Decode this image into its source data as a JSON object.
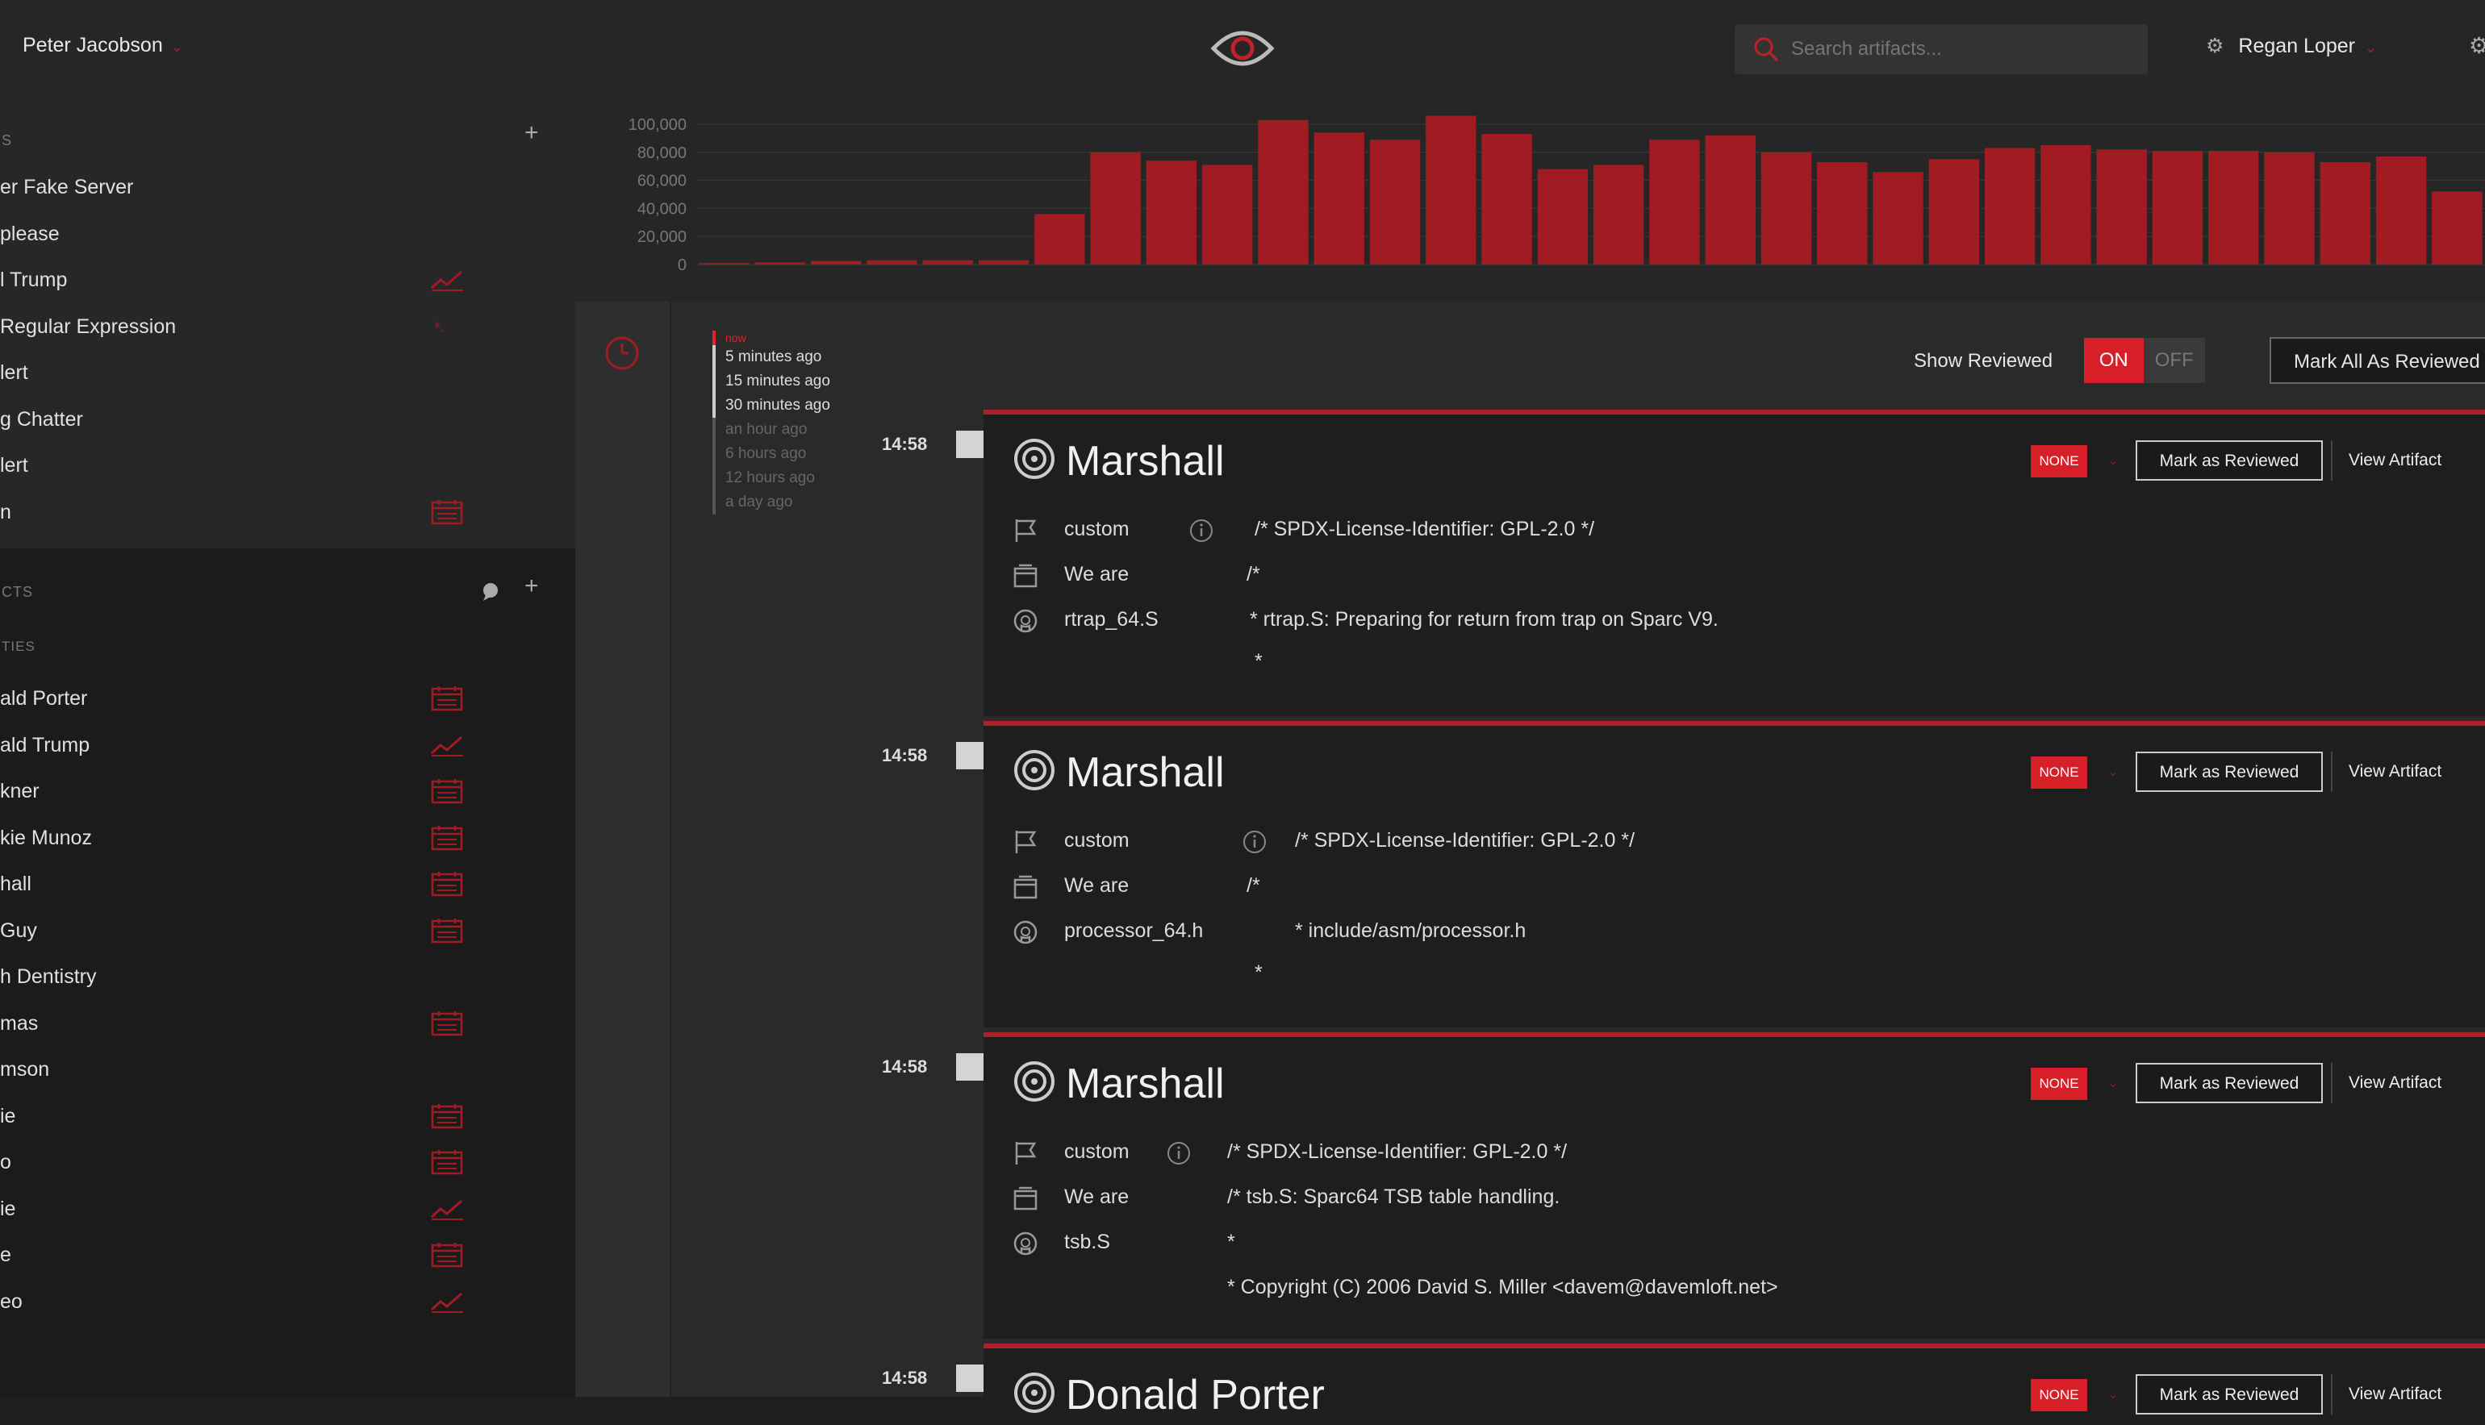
{
  "header": {
    "user_left": "Peter Jacobson",
    "search_placeholder": "Search artifacts...",
    "user_right": "Regan Loper"
  },
  "sidebar": {
    "section1_label": "S",
    "section1_items": [
      {
        "label": "er Fake Server",
        "icon": ""
      },
      {
        "label": "please",
        "icon": ""
      },
      {
        "label": "l Trump",
        "icon": "graph-icon"
      },
      {
        "label": "Regular Expression",
        "icon": "regex-icon"
      },
      {
        "label": "lert",
        "icon": ""
      },
      {
        "label": "g Chatter",
        "icon": ""
      },
      {
        "label": "lert",
        "icon": ""
      },
      {
        "label": "n",
        "icon": "calendar-icon"
      }
    ],
    "section2_label": "CTS",
    "section2_sub": "TIES",
    "section2_items": [
      {
        "label": "ald Porter",
        "icon": "calendar-icon"
      },
      {
        "label": "ald Trump",
        "icon": "graph-icon"
      },
      {
        "label": "kner",
        "icon": "calendar-icon"
      },
      {
        "label": "kie Munoz",
        "icon": "calendar-icon"
      },
      {
        "label": "hall",
        "icon": "calendar-icon"
      },
      {
        "label": " Guy",
        "icon": "calendar-icon"
      },
      {
        "label": "h Dentistry",
        "icon": ""
      },
      {
        "label": "mas",
        "icon": "calendar-icon"
      },
      {
        "label": "mson",
        "icon": ""
      },
      {
        "label": "ie",
        "icon": "calendar-icon"
      },
      {
        "label": "o",
        "icon": "calendar-icon"
      },
      {
        "label": "ie",
        "icon": "graph-icon"
      },
      {
        "label": "e",
        "icon": "calendar-icon"
      },
      {
        "label": "eo",
        "icon": "graph-icon"
      }
    ]
  },
  "chart_data": {
    "type": "bar",
    "yticks": [
      "100,000",
      "80,000",
      "60,000",
      "40,000",
      "20,000",
      "0"
    ],
    "ylim": [
      0,
      100000
    ],
    "values": [
      1000,
      1500,
      2500,
      3000,
      3000,
      3000,
      36000,
      80000,
      74000,
      71000,
      103000,
      94000,
      89000,
      106000,
      93000,
      68000,
      71000,
      89000,
      92000,
      80000,
      73000,
      66000,
      75000,
      83000,
      85000,
      82000,
      81000,
      81000,
      80000,
      73000,
      77000,
      52000
    ],
    "color": "#a01c22"
  },
  "timeline": {
    "filters": [
      {
        "label": "now",
        "state": "now"
      },
      {
        "label": "5 minutes ago",
        "state": "active"
      },
      {
        "label": "15 minutes ago",
        "state": "active"
      },
      {
        "label": "30 minutes ago",
        "state": "active"
      },
      {
        "label": "an hour ago",
        "state": "dim"
      },
      {
        "label": "6 hours ago",
        "state": "dim"
      },
      {
        "label": "12 hours ago",
        "state": "dim"
      },
      {
        "label": "a day ago",
        "state": "dim"
      }
    ]
  },
  "controls": {
    "show_reviewed": "Show Reviewed",
    "on": "ON",
    "off": "OFF",
    "mark_all": "Mark All As Reviewed"
  },
  "cards": [
    {
      "time": "14:58",
      "title": "Marshall",
      "badge": "NONE",
      "mark": "Mark as Reviewed",
      "view": "View Artifact",
      "rows": [
        {
          "icon": "flag-icon",
          "label": "custom",
          "value": "/* SPDX-License-Identifier: GPL-2.0 */"
        },
        {
          "icon": "box-icon",
          "label": "We are",
          "value": "/*"
        },
        {
          "icon": "github-icon",
          "label": "rtrap_64.S",
          "value": "* rtrap.S: Preparing for return from trap on Sparc V9."
        }
      ],
      "cont": "*"
    },
    {
      "time": "14:58",
      "title": "Marshall",
      "badge": "NONE",
      "mark": "Mark as Reviewed",
      "view": "View Artifact",
      "rows": [
        {
          "icon": "flag-icon",
          "label": "custom",
          "value": "/* SPDX-License-Identifier: GPL-2.0 */"
        },
        {
          "icon": "box-icon",
          "label": "We are",
          "value": "/*"
        },
        {
          "icon": "github-icon",
          "label": "processor_64.h",
          "value": "* include/asm/processor.h"
        }
      ],
      "cont": "*"
    },
    {
      "time": "14:58",
      "title": "Marshall",
      "badge": "NONE",
      "mark": "Mark as Reviewed",
      "view": "View Artifact",
      "rows": [
        {
          "icon": "flag-icon",
          "label": "custom",
          "value": "/* SPDX-License-Identifier: GPL-2.0 */"
        },
        {
          "icon": "box-icon",
          "label": "We are",
          "value": "/* tsb.S: Sparc64 TSB table handling."
        },
        {
          "icon": "github-icon",
          "label": "tsb.S",
          "value": "*"
        }
      ],
      "cont": "* Copyright (C) 2006 David S. Miller <davem@davemloft.net>"
    },
    {
      "time": "14:58",
      "title": "Donald Porter",
      "badge": "NONE",
      "mark": "Mark as Reviewed",
      "view": "View Artifact"
    }
  ]
}
